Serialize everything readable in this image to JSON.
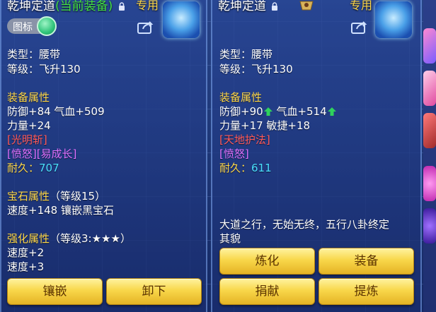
{
  "colors": {
    "section": "#ffd84a",
    "current_equip": "#44e044",
    "red_tag": "#ff5a5a",
    "purple_tag": "#e070ff",
    "durability": "#4ae0ff",
    "button": "#f8d74a",
    "increase_arrow": "#2fd25c"
  },
  "left": {
    "title": "乾坤定道",
    "title_current": "(当前装备)",
    "exclusive": "专用",
    "toggle_label": "图标",
    "toggle_on": true,
    "type": "类型：腰带",
    "level": "等级：飞升130",
    "attr_header": "装备属性",
    "attr_line1": "防御+84 气血+509",
    "attr_line2": "力量+24",
    "skill_tag": "[光明斩]",
    "special_tag": "[愤怒][易成长]",
    "durability_label": "耐久：",
    "durability_value": "707",
    "gem_header": "宝石属性",
    "gem_level": "（等级15）",
    "gem_line": "速度+148 镶嵌黑宝石",
    "enhance_header": "强化属性",
    "enhance_level": "（等级3:★★★）",
    "enhance_line1": "速度+2",
    "enhance_line2": "速度+3",
    "btn_inlay": "镶嵌",
    "btn_unequip": "卸下"
  },
  "right": {
    "title": "乾坤定道",
    "exclusive": "专用",
    "type": "类型：腰带",
    "level": "等级：飞升130",
    "attr_header": "装备属性",
    "attr_def": "防御+90",
    "attr_hp": "气血+514",
    "attr_line2": "力量+17 敏捷+18",
    "skill_tag": "[天地护法]",
    "special_tag": "[愤怒]",
    "durability_label": "耐久：",
    "durability_value": "611",
    "description": "大道之行，无始无终，五行八卦终定",
    "description2": "其貌",
    "btn_refine": "炼化",
    "btn_equip": "装备",
    "btn_donate": "捐献",
    "btn_extract": "提炼"
  }
}
